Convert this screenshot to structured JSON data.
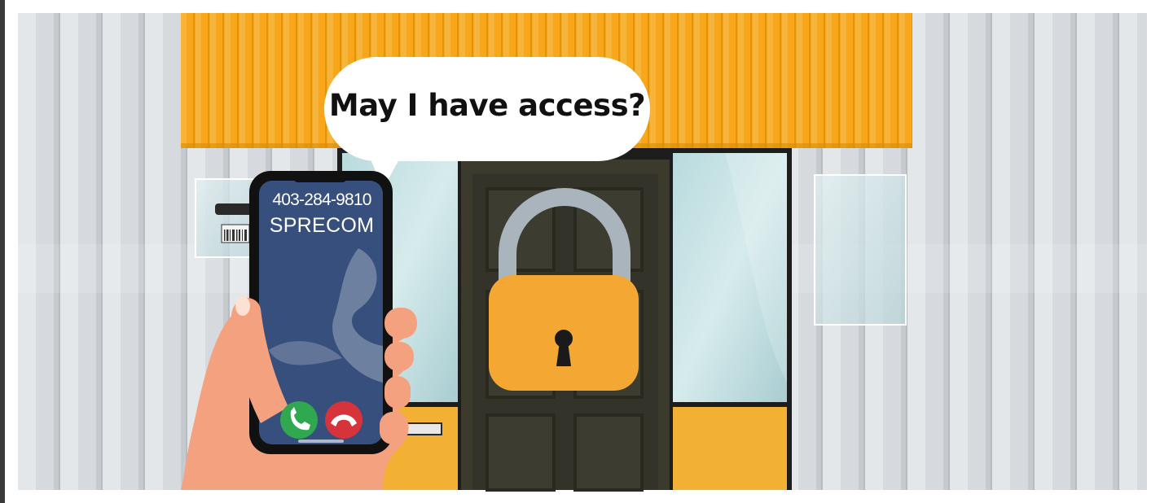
{
  "scene": {
    "speech_bubble": {
      "text": "May I have access?"
    },
    "phone": {
      "number": "403-284-9810",
      "caller": "SPRECOM",
      "accept_icon": "phone-accept-icon",
      "decline_icon": "phone-decline-icon"
    },
    "door": {
      "lock_icon": "padlock-icon"
    },
    "colors": {
      "awning": "#f9a61a",
      "door": "#3b3a2c",
      "phone_screen": "#374f7c",
      "padlock_body": "#f5a733",
      "padlock_shackle": "#a9b4bc",
      "accept": "#2fa84f",
      "decline": "#d6343a"
    }
  }
}
